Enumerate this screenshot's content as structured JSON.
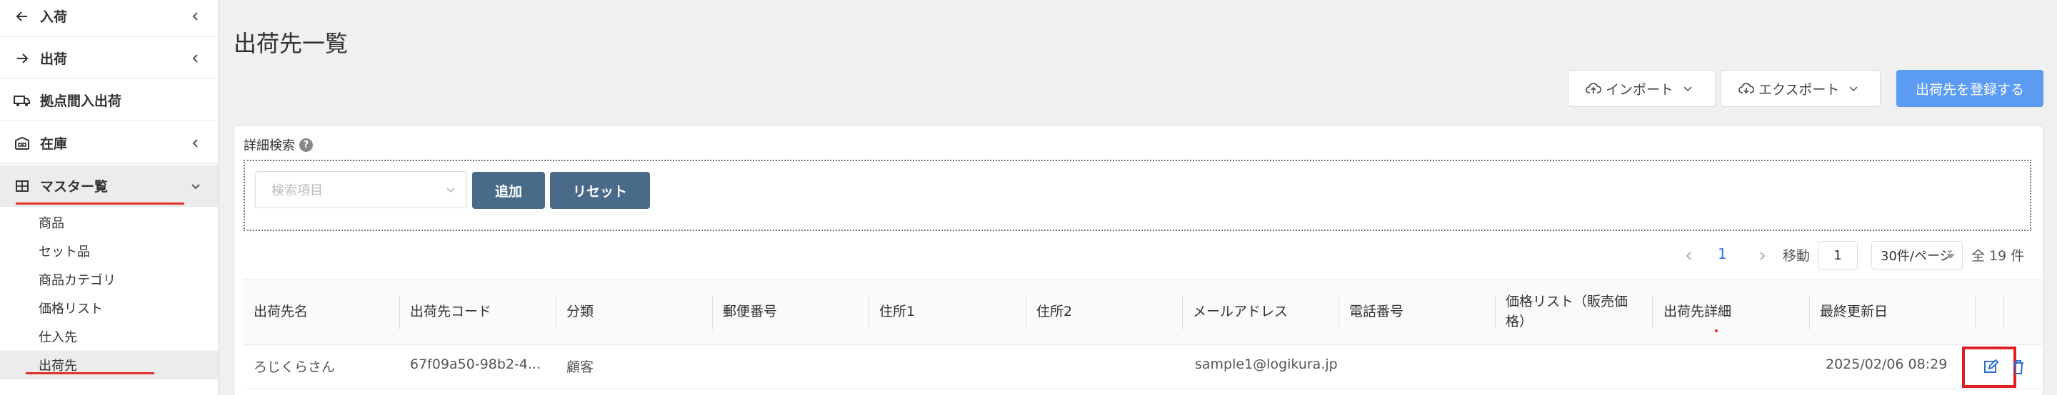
{
  "sidebar": {
    "items": [
      {
        "label": "入荷",
        "icon": "arrow-left-icon"
      },
      {
        "label": "出荷",
        "icon": "arrow-right-icon"
      },
      {
        "label": "拠点間入出荷",
        "icon": "truck-icon"
      },
      {
        "label": "在庫",
        "icon": "warehouse-icon"
      },
      {
        "label": "マスター覧",
        "icon": "grid-icon"
      }
    ],
    "sub_items": [
      "商品",
      "セット品",
      "商品カテゴリ",
      "価格リスト",
      "仕入先",
      "出荷先"
    ]
  },
  "page": {
    "title": "出荷先一覧"
  },
  "toolbar": {
    "import_label": "インポート",
    "export_label": "エクスポート",
    "register_label": "出荷先を登録する"
  },
  "search": {
    "title": "詳細検索",
    "help": "?",
    "placeholder": "検索項目",
    "add_label": "追加",
    "reset_label": "リセット"
  },
  "pagination": {
    "current_page": "1",
    "goto_label": "移動",
    "goto_value": "1",
    "page_size": "30件/ページ",
    "total": "全 19 件"
  },
  "table": {
    "columns": [
      "出荷先名",
      "出荷先コード",
      "分類",
      "郵便番号",
      "住所1",
      "住所2",
      "メールアドレス",
      "電話番号",
      "価格リスト（販売価格）",
      "出荷先詳細",
      "最終更新日"
    ],
    "rows": [
      {
        "name": "ろじくらさん",
        "code": "67f09a50-98b2-4...",
        "category": "顧客",
        "postal": "",
        "address1": "",
        "address2": "",
        "email": "sample1@logikura.jp",
        "phone": "",
        "price_list": "",
        "detail": "",
        "updated": "2025/02/06 08:29"
      }
    ]
  },
  "colors": {
    "primary": "#5b9cf2",
    "dark_button": "#4a6a8a",
    "highlight": "#e02020",
    "link": "#3a78d8"
  }
}
